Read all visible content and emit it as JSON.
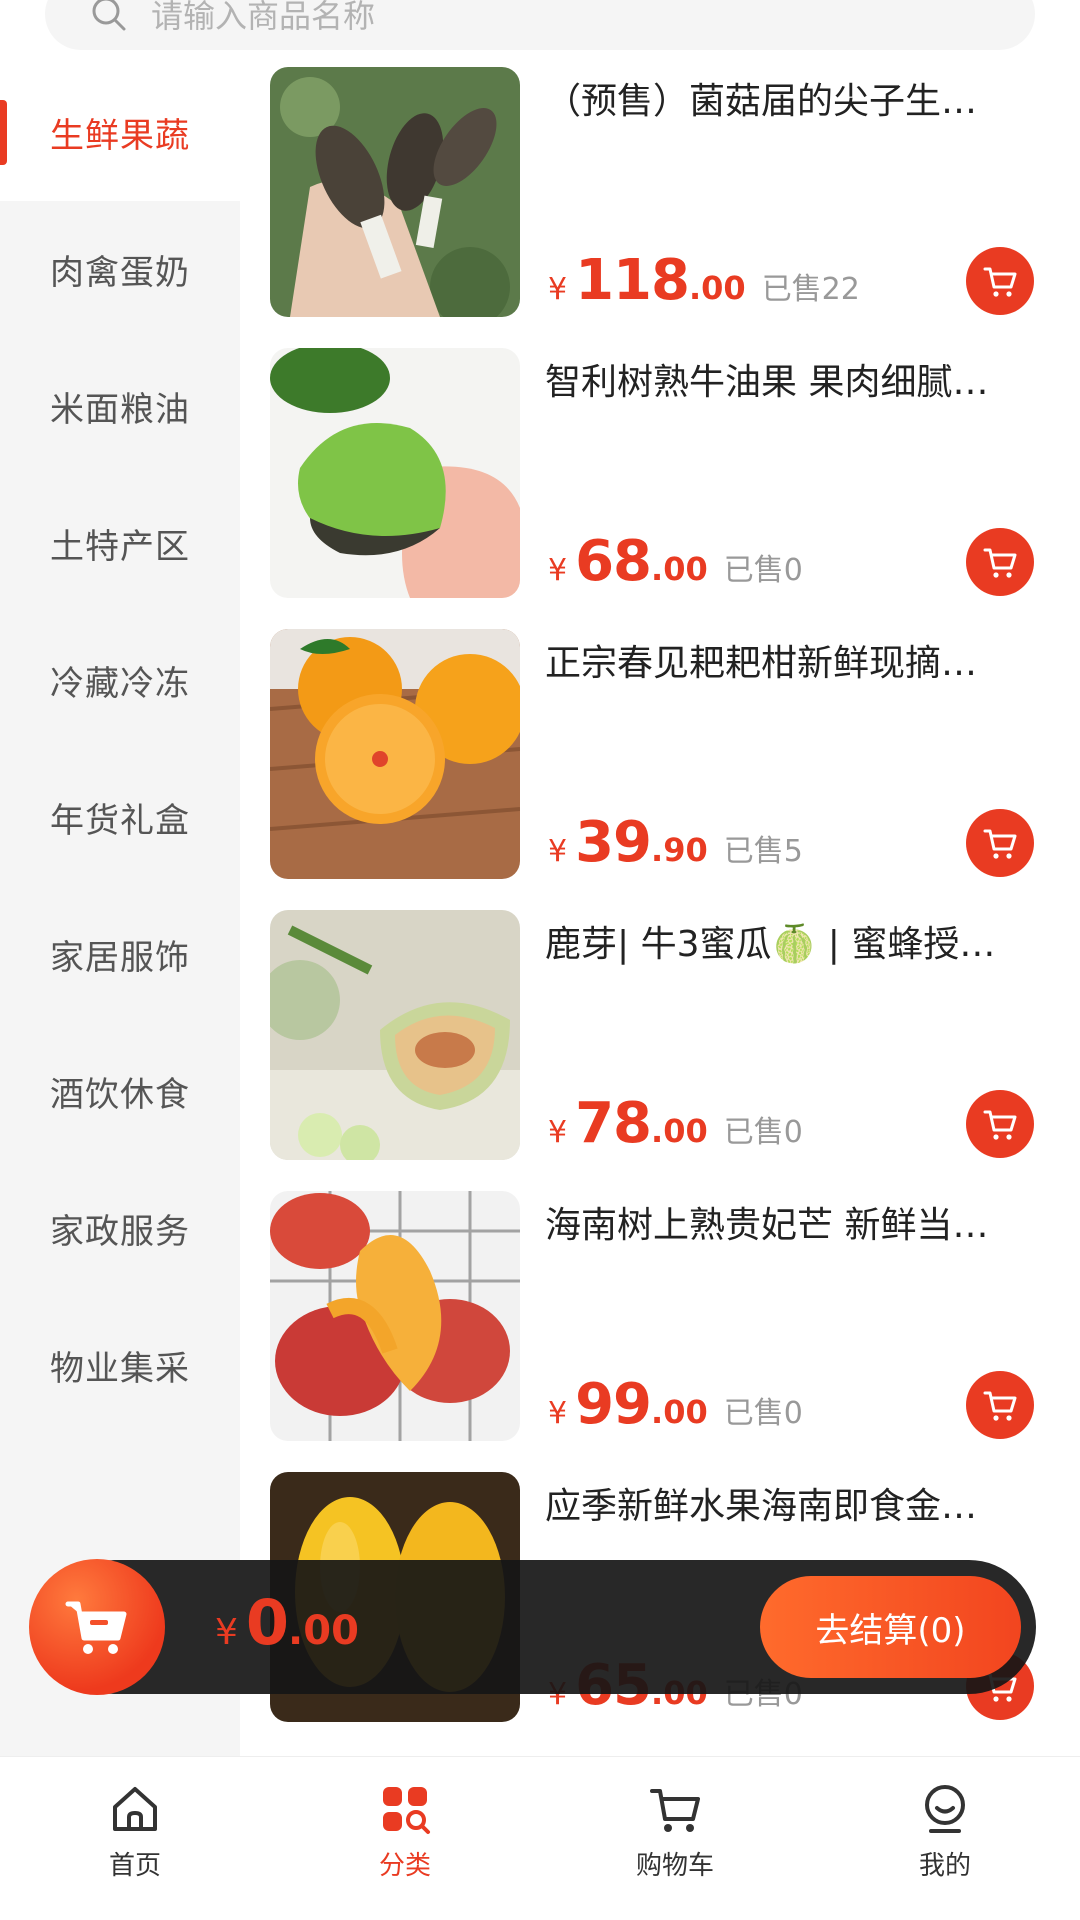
{
  "search": {
    "placeholder": "请输入商品名称",
    "icon": "search-icon"
  },
  "sidebar": {
    "items": [
      {
        "label": "生鲜果蔬",
        "active": true
      },
      {
        "label": "肉禽蛋奶"
      },
      {
        "label": "米面粮油"
      },
      {
        "label": "土特产区"
      },
      {
        "label": "冷藏冷冻"
      },
      {
        "label": "年货礼盒"
      },
      {
        "label": "家居服饰"
      },
      {
        "label": "酒饮休食"
      },
      {
        "label": "家政服务"
      },
      {
        "label": "物业集采"
      }
    ]
  },
  "products": [
    {
      "title": "（预售）菌菇届的尖子生…",
      "currency": "¥",
      "price_int": "118",
      "price_dec": ".00",
      "sold": "已售22"
    },
    {
      "title": "智利树熟牛油果 果肉细腻…",
      "currency": "¥",
      "price_int": "68",
      "price_dec": ".00",
      "sold": "已售0"
    },
    {
      "title": "正宗春见耙耙柑新鲜现摘…",
      "currency": "¥",
      "price_int": "39",
      "price_dec": ".90",
      "sold": "已售5"
    },
    {
      "title": "鹿芽| 牛3蜜瓜🍈 | 蜜蜂授…",
      "currency": "¥",
      "price_int": "78",
      "price_dec": ".00",
      "sold": "已售0"
    },
    {
      "title": "海南树上熟贵妃芒 新鲜当…",
      "currency": "¥",
      "price_int": "99",
      "price_dec": ".00",
      "sold": "已售0"
    },
    {
      "title": "应季新鲜水果海南即食金…",
      "currency": "¥",
      "price_int": "65",
      "price_dec": ".00",
      "sold": "已售0"
    }
  ],
  "checkout": {
    "currency": "¥",
    "total_int": "0",
    "total_dec": ".00",
    "button_label": "去结算(0)"
  },
  "tabbar": {
    "tabs": [
      {
        "label": "首页",
        "icon": "home-icon"
      },
      {
        "label": "分类",
        "icon": "category-icon",
        "active": true
      },
      {
        "label": "购物车",
        "icon": "cart-icon"
      },
      {
        "label": "我的",
        "icon": "profile-icon"
      }
    ]
  },
  "colors": {
    "accent": "#e93b22",
    "sidebar_bg": "#f5f5f5",
    "checkout_bar": "#161616"
  }
}
